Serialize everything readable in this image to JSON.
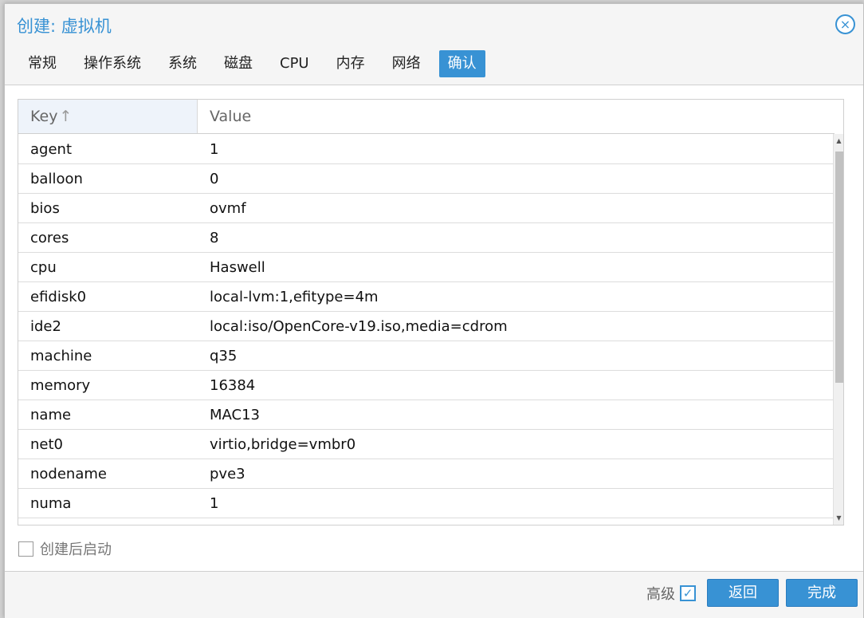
{
  "dialog": {
    "title": "创建: 虚拟机",
    "close_icon": "×"
  },
  "tabs": [
    {
      "label": "常规"
    },
    {
      "label": "操作系统"
    },
    {
      "label": "系统"
    },
    {
      "label": "磁盘"
    },
    {
      "label": "CPU"
    },
    {
      "label": "内存"
    },
    {
      "label": "网络"
    },
    {
      "label": "确认",
      "active": true
    }
  ],
  "grid": {
    "columns": {
      "key": "Key",
      "key_sort_icon": "↑",
      "value": "Value"
    },
    "rows": [
      {
        "key": "agent",
        "value": "1"
      },
      {
        "key": "balloon",
        "value": "0"
      },
      {
        "key": "bios",
        "value": "ovmf"
      },
      {
        "key": "cores",
        "value": "8"
      },
      {
        "key": "cpu",
        "value": "Haswell"
      },
      {
        "key": "efidisk0",
        "value": "local-lvm:1,efitype=4m"
      },
      {
        "key": "ide2",
        "value": "local:iso/OpenCore-v19.iso,media=cdrom"
      },
      {
        "key": "machine",
        "value": "q35"
      },
      {
        "key": "memory",
        "value": "16384"
      },
      {
        "key": "name",
        "value": "MAC13"
      },
      {
        "key": "net0",
        "value": "virtio,bridge=vmbr0"
      },
      {
        "key": "nodename",
        "value": "pve3"
      },
      {
        "key": "numa",
        "value": "1"
      }
    ]
  },
  "start_after_create": {
    "label": "创建后启动",
    "checked": false
  },
  "footer": {
    "advanced_label": "高级",
    "advanced_checked": true,
    "advanced_check_icon": "✓",
    "back_label": "返回",
    "finish_label": "完成"
  },
  "colors": {
    "accent": "#3892d4",
    "dialog_bg": "#f5f5f5",
    "header_key_bg": "#eef3fa"
  }
}
